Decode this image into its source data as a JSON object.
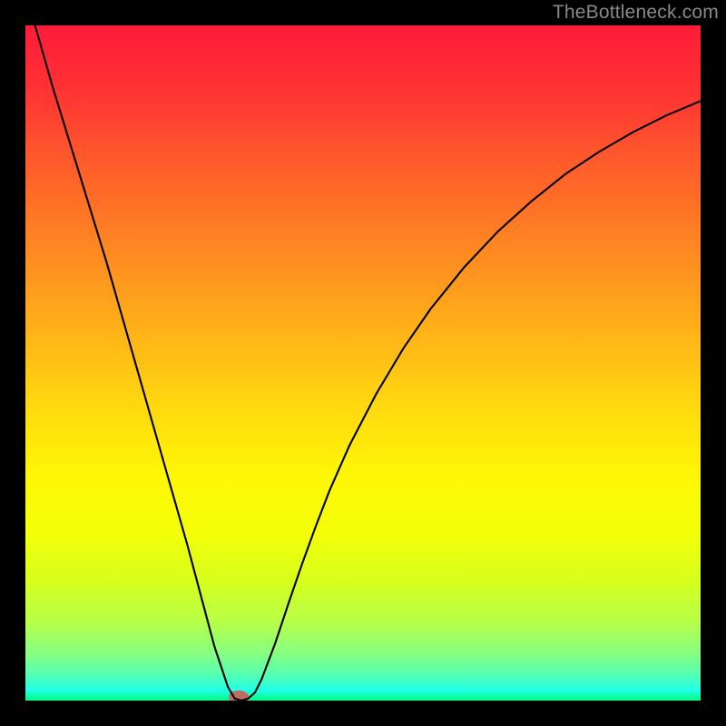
{
  "watermark": "TheBottleneck.com",
  "chart_data": {
    "type": "line",
    "title": "",
    "xlabel": "",
    "ylabel": "",
    "xlim": [
      0,
      100
    ],
    "ylim": [
      0,
      100
    ],
    "x": [
      0,
      2,
      4,
      6,
      8,
      10,
      12,
      14,
      16,
      18,
      20,
      22,
      24,
      26,
      28,
      30,
      31,
      32,
      33,
      34,
      35,
      37,
      39,
      41,
      43,
      45,
      48,
      52,
      56,
      60,
      65,
      70,
      75,
      80,
      85,
      90,
      95,
      100
    ],
    "values": [
      105,
      98,
      91,
      84.5,
      78,
      71.5,
      65,
      58,
      51,
      44,
      37,
      30,
      23,
      15.5,
      8,
      2,
      0.3,
      0,
      0.3,
      1.2,
      3.2,
      8.5,
      14.5,
      20.3,
      25.8,
      31,
      37.8,
      45.5,
      52.2,
      58,
      64.2,
      69.5,
      74,
      78,
      81.3,
      84.2,
      86.7,
      88.8
    ],
    "legend": null,
    "grid": false,
    "annotations": []
  },
  "background": {
    "gradient_stops": [
      {
        "offset": 0.0,
        "color": "#ff1c39"
      },
      {
        "offset": 0.09,
        "color": "#ff3034"
      },
      {
        "offset": 0.2,
        "color": "#ff5a2b"
      },
      {
        "offset": 0.32,
        "color": "#ff8422"
      },
      {
        "offset": 0.44,
        "color": "#ffad19"
      },
      {
        "offset": 0.56,
        "color": "#ffd70f"
      },
      {
        "offset": 0.66,
        "color": "#fff506"
      },
      {
        "offset": 0.75,
        "color": "#f4ff07"
      },
      {
        "offset": 0.82,
        "color": "#d8ff1c"
      },
      {
        "offset": 0.885,
        "color": "#b6ff48"
      },
      {
        "offset": 0.935,
        "color": "#80ff89"
      },
      {
        "offset": 0.965,
        "color": "#4fffba"
      },
      {
        "offset": 0.985,
        "color": "#1fffe8"
      },
      {
        "offset": 1.0,
        "color": "#00ff7f"
      }
    ],
    "frame_color": "#000000"
  },
  "marker": {
    "x_pct": 31.6,
    "y_pct": 0.5,
    "rx_pct": 1.5,
    "ry_pct": 1.0,
    "fill": "#c26b63"
  },
  "curve_style": {
    "stroke": "#000000",
    "stroke_width": 2.1
  }
}
